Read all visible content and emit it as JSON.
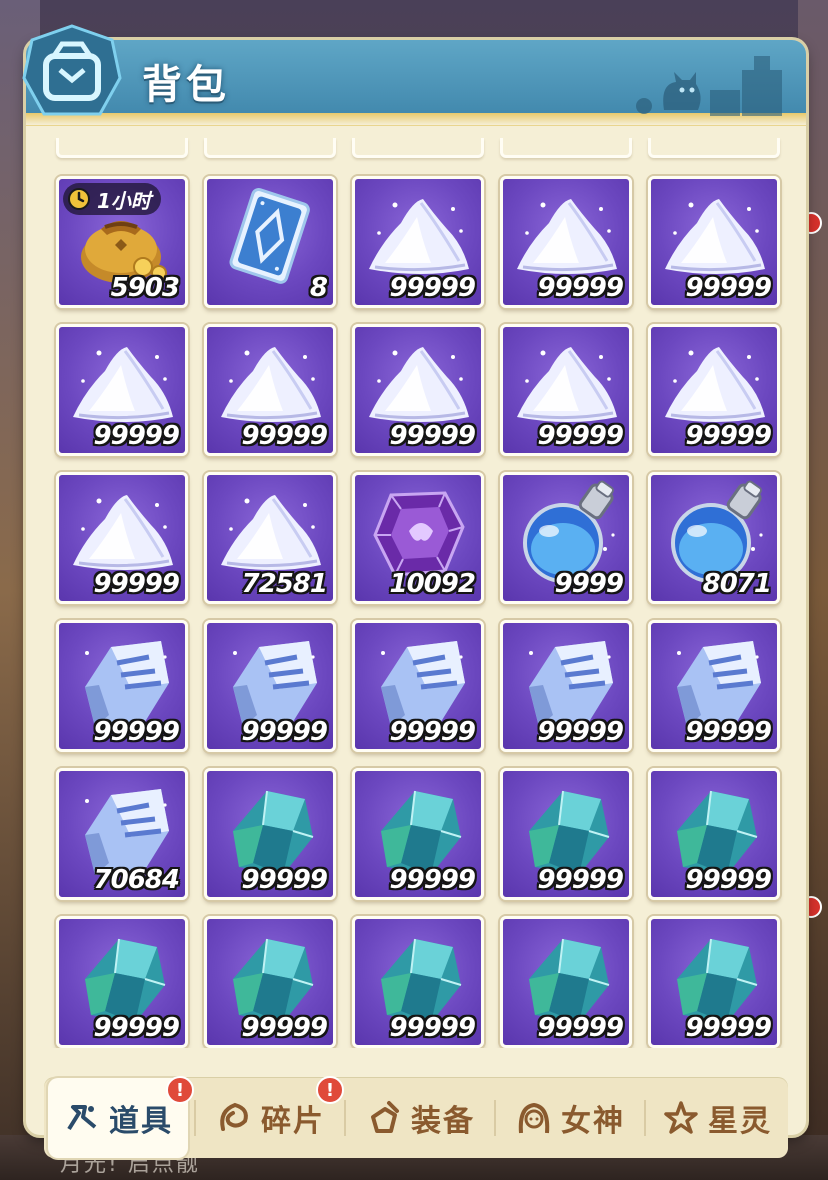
{
  "window": {
    "title": "背包"
  },
  "grid": {
    "rows": [
      [
        {
          "icon": "gold-pouch-icon",
          "quantity": "5903",
          "timer": "1小时"
        },
        {
          "icon": "blue-card-icon",
          "quantity": "8"
        },
        {
          "icon": "white-crystal-pile-icon",
          "quantity": "99999"
        },
        {
          "icon": "white-crystal-pile-icon",
          "quantity": "99999"
        },
        {
          "icon": "white-crystal-pile-icon",
          "quantity": "99999"
        }
      ],
      [
        {
          "icon": "white-crystal-pile-icon",
          "quantity": "99999"
        },
        {
          "icon": "white-crystal-pile-icon",
          "quantity": "99999"
        },
        {
          "icon": "white-crystal-pile-icon",
          "quantity": "99999"
        },
        {
          "icon": "white-crystal-pile-icon",
          "quantity": "99999"
        },
        {
          "icon": "white-crystal-pile-icon",
          "quantity": "99999"
        }
      ],
      [
        {
          "icon": "white-crystal-pile-icon",
          "quantity": "99999"
        },
        {
          "icon": "white-crystal-pile-icon",
          "quantity": "72581"
        },
        {
          "icon": "purple-gem-icon",
          "quantity": "10092"
        },
        {
          "icon": "blue-potion-icon",
          "quantity": "9999"
        },
        {
          "icon": "blue-potion-icon",
          "quantity": "8071"
        }
      ],
      [
        {
          "icon": "ice-ore-icon",
          "quantity": "99999"
        },
        {
          "icon": "ice-ore-icon",
          "quantity": "99999"
        },
        {
          "icon": "ice-ore-icon",
          "quantity": "99999"
        },
        {
          "icon": "ice-ore-icon",
          "quantity": "99999"
        },
        {
          "icon": "ice-ore-icon",
          "quantity": "99999"
        }
      ],
      [
        {
          "icon": "ice-ore-icon",
          "quantity": "70684"
        },
        {
          "icon": "teal-crystal-icon",
          "quantity": "99999"
        },
        {
          "icon": "teal-crystal-icon",
          "quantity": "99999"
        },
        {
          "icon": "teal-crystal-icon",
          "quantity": "99999"
        },
        {
          "icon": "teal-crystal-icon",
          "quantity": "99999"
        }
      ],
      [
        {
          "icon": "teal-crystal-icon",
          "quantity": "99999"
        },
        {
          "icon": "teal-crystal-icon",
          "quantity": "99999"
        },
        {
          "icon": "teal-crystal-icon",
          "quantity": "99999"
        },
        {
          "icon": "teal-crystal-icon",
          "quantity": "99999"
        },
        {
          "icon": "teal-crystal-icon",
          "quantity": "99999"
        }
      ]
    ]
  },
  "tabs": [
    {
      "label": "道具",
      "icon": "items-icon",
      "active": true,
      "alert": "!"
    },
    {
      "label": "碎片",
      "icon": "fragments-icon",
      "active": false,
      "alert": "!"
    },
    {
      "label": "装备",
      "icon": "equipment-icon",
      "active": false
    },
    {
      "label": "女神",
      "icon": "goddess-icon",
      "active": false
    },
    {
      "label": "星灵",
      "icon": "star-spirit-icon",
      "active": false
    }
  ],
  "background": {
    "bottom_text": "月光!  启点靓"
  },
  "colors": {
    "header": "#4f96b8",
    "panel": "#f5efd6",
    "cell": "#6c48c0",
    "alert": "#e04a3a"
  }
}
